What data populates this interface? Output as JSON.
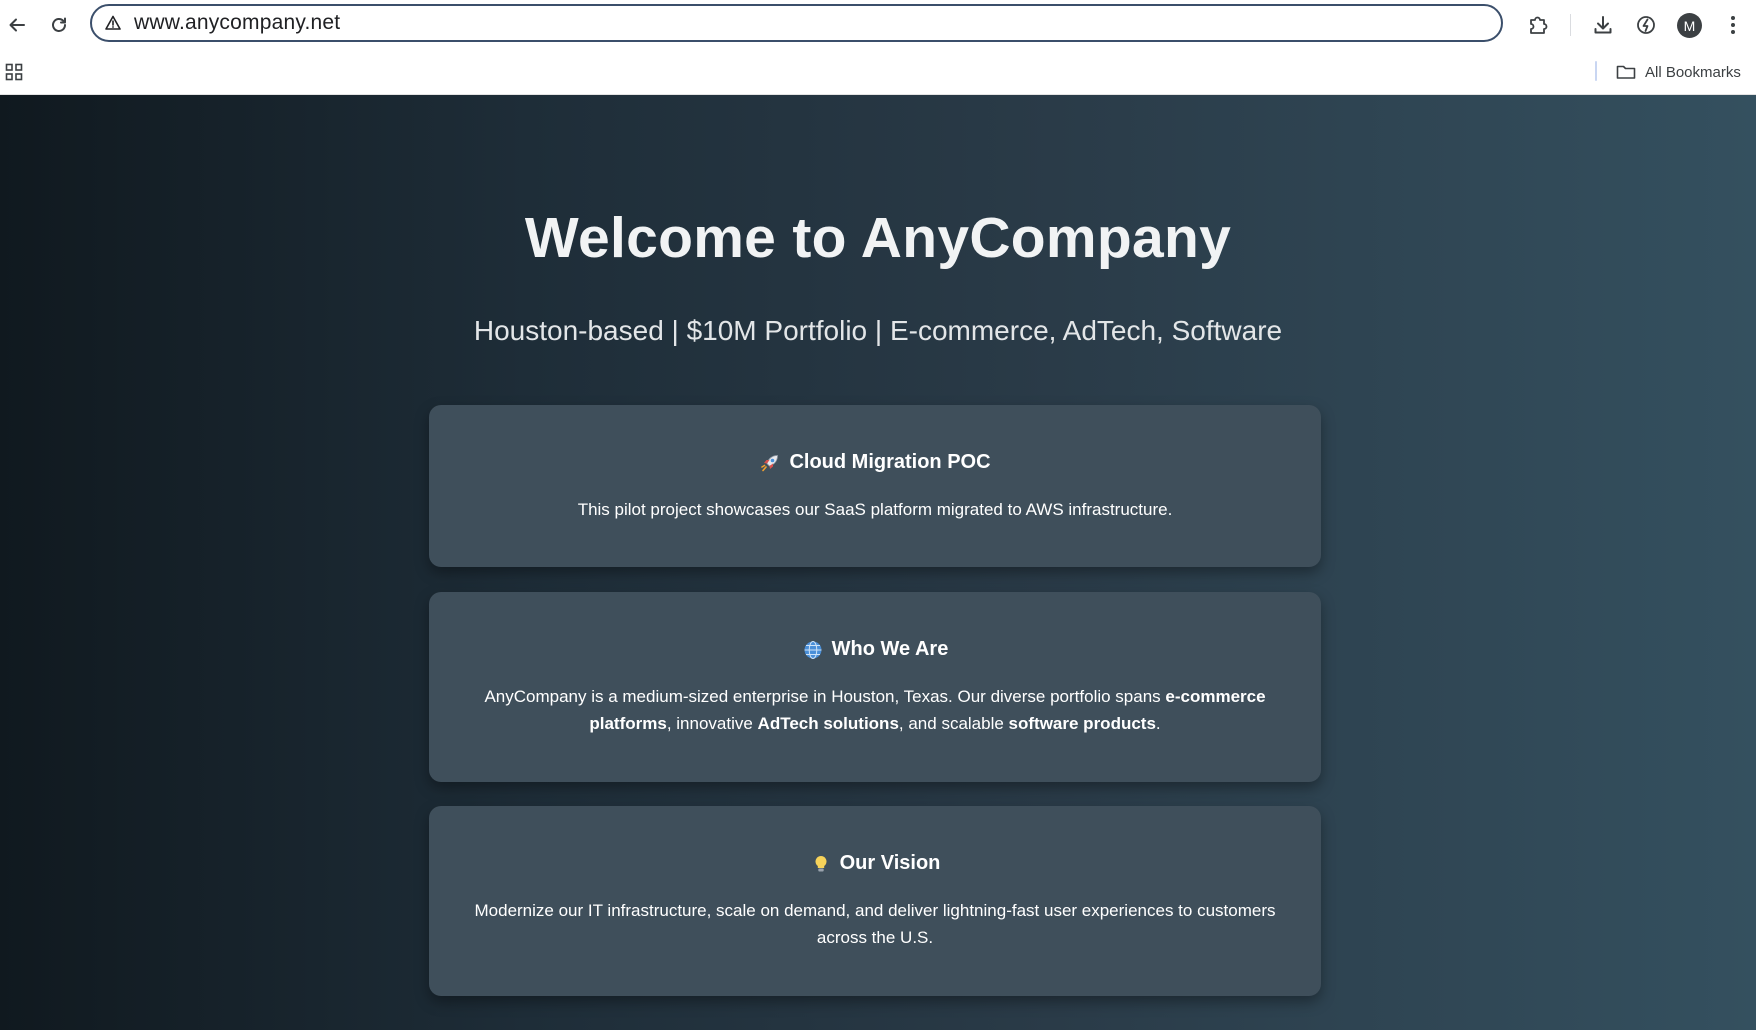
{
  "browser": {
    "url": "www.anycompany.net",
    "avatar_initial": "M",
    "all_bookmarks_label": "All Bookmarks"
  },
  "hero": {
    "title": "Welcome to AnyCompany",
    "subtitle": "Houston-based | $10M Portfolio | E-commerce, AdTech, Software"
  },
  "cards": [
    {
      "icon": "rocket-icon",
      "title": "Cloud Migration POC",
      "text": "This pilot project showcases our SaaS platform migrated to AWS infrastructure."
    },
    {
      "icon": "globe-icon",
      "title": "Who We Are",
      "text_parts": [
        "AnyCompany is a medium-sized enterprise in Houston, Texas. Our diverse portfolio spans ",
        "e-commerce platforms",
        ", innovative ",
        "AdTech solutions",
        ", and scalable ",
        "software products",
        "."
      ]
    },
    {
      "icon": "lightbulb-icon",
      "title": "Our Vision",
      "text": "Modernize our IT infrastructure, scale on demand, and deliver lightning-fast user experiences to customers across the U.S."
    }
  ],
  "colors": {
    "card_bg": "#3f4f5b",
    "omnibox_border": "#3b4f6b",
    "gradient_left": "#10191f",
    "gradient_right": "#34505f"
  }
}
